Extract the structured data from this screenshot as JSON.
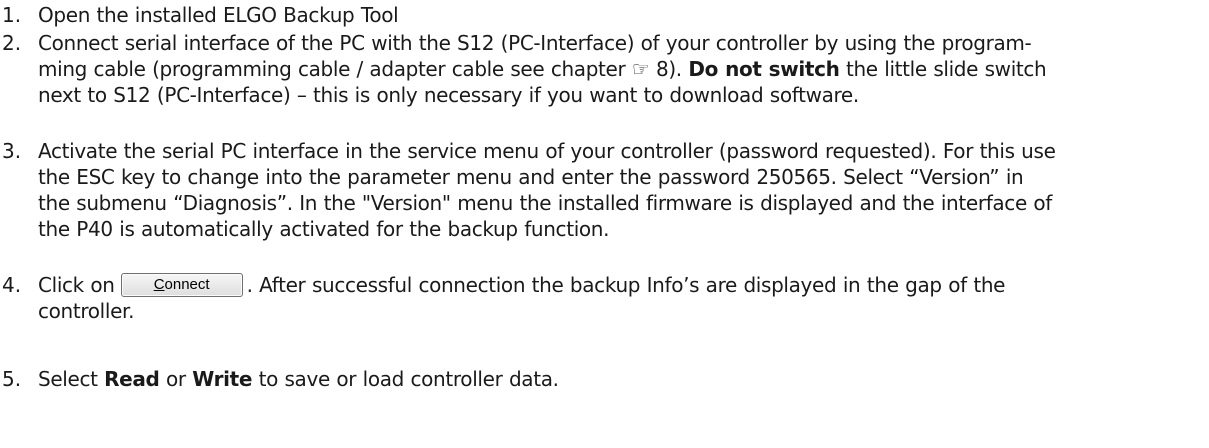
{
  "steps": [
    {
      "number": "1.",
      "text": "Open the installed ELGO Backup Tool"
    },
    {
      "number": "2.",
      "line1": "Connect serial interface of the PC with the S12 (PC-Interface) of your controller by using the program-",
      "line2_a": "ming cable (programming cable / adapter cable see chapter ☞ 8). ",
      "line2_bold": "Do not switch",
      "line2_b": " the little slide switch",
      "line3": "next to S12 (PC-Interface) – this is only necessary if you want to download software."
    },
    {
      "number": "3.",
      "line1": "Activate the serial PC interface in the service menu of your controller (password requested). For this use",
      "line2": "the ESC key to change into the parameter menu and enter the password 250565. Select “Version” in",
      "line3": "the submenu “Diagnosis”. In the \"Version\" menu the installed firmware is displayed and the interface of",
      "line4": "the P40 is automatically activated for the backup function."
    },
    {
      "number": "4.",
      "before": "Click on",
      "button_mnemonic": "C",
      "button_rest": "onnect",
      "after": ". After successful connection the backup Info’s are displayed in the gap of the",
      "line2": "controller."
    },
    {
      "number": "5.",
      "before": "Select ",
      "bold1": "Read",
      "middle": " or ",
      "bold2": "Write",
      "after": " to save or load controller data."
    }
  ]
}
